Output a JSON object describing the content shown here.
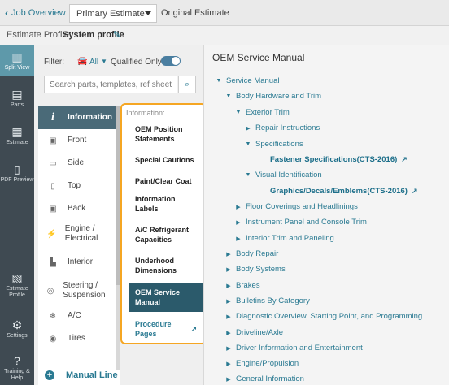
{
  "header": {
    "back_label": "Job Overview",
    "estimate_selected": "Primary Estimate",
    "original_estimate": "Original Estimate"
  },
  "profile": {
    "label": "Estimate Profile:",
    "value": "System profile"
  },
  "rail": [
    {
      "label": "Split View",
      "icon": "split-view-icon"
    },
    {
      "label": "Parts",
      "icon": "parts-icon"
    },
    {
      "label": "Estimate",
      "icon": "estimate-icon"
    },
    {
      "label": "PDF Preview",
      "icon": "pdf-icon"
    },
    {
      "label": "Estimate Profile",
      "icon": "estimate-profile-icon"
    },
    {
      "label": "Settings",
      "icon": "gear-icon"
    },
    {
      "label": "Training & Help",
      "icon": "help-icon"
    }
  ],
  "filter": {
    "label": "Filter:",
    "value": "All",
    "qualified_label": "Qualified Only",
    "qualified_on": true,
    "search_placeholder": "Search parts, templates, ref sheet"
  },
  "categories": [
    {
      "label": "Information",
      "icon": "i"
    },
    {
      "label": "Front",
      "icon": "car-front-icon"
    },
    {
      "label": "Side",
      "icon": "car-side-icon"
    },
    {
      "label": "Top",
      "icon": "car-top-icon"
    },
    {
      "label": "Back",
      "icon": "car-back-icon"
    },
    {
      "label": "Engine / Electrical",
      "icon": "engine-icon"
    },
    {
      "label": "Interior",
      "icon": "seat-icon"
    },
    {
      "label": "Steering / Suspension",
      "icon": "steering-icon"
    },
    {
      "label": "A/C",
      "icon": "ac-icon"
    },
    {
      "label": "Tires",
      "icon": "tire-icon"
    }
  ],
  "manual_line": "Manual Line",
  "popup": {
    "title": "Information:",
    "items": [
      "OEM Position Statements",
      "Special Cautions",
      "Paint/Clear Coat",
      "Information Labels",
      "A/C Refrigerant Capacities",
      "Underhood Dimensions",
      "OEM Service Manual",
      "Procedure Pages"
    ]
  },
  "main": {
    "title": "OEM Service Manual",
    "tree": [
      "Service Manual",
      "Body Hardware and Trim",
      "Exterior Trim",
      "Repair Instructions",
      "Specifications",
      "Fastener Specifications(CTS-2016)",
      "Visual Identification",
      "Graphics/Decals/Emblems(CTS-2016)",
      "Floor Coverings and Headlinings",
      "Instrument Panel and Console Trim",
      "Interior Trim and Paneling",
      "Body Repair",
      "Body Systems",
      "Brakes",
      "Bulletins By Category",
      "Diagnostic Overview, Starting Point, and Programming",
      "Driveline/Axle",
      "Driver Information and Entertainment",
      "Engine/Propulsion",
      "General Information"
    ]
  }
}
